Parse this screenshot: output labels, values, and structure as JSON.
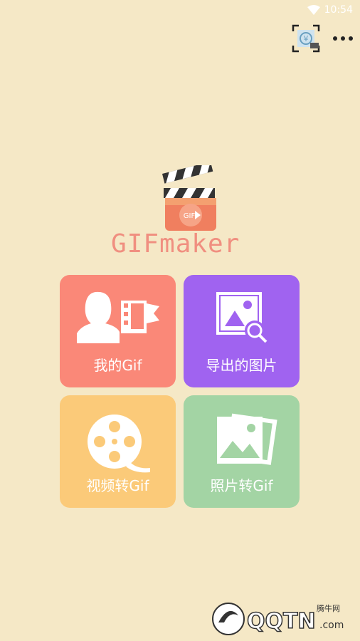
{
  "status_bar": {
    "time": "10:54"
  },
  "top_actions": {
    "donate_icon": "donate-code-icon",
    "more_icon": "more-dots-icon"
  },
  "logo": {
    "title": "GIFmaker",
    "badge": "GIF"
  },
  "tiles": [
    {
      "label": "我的Gif",
      "icon": "person-film-icon",
      "color": "#fa8878"
    },
    {
      "label": "导出的图片",
      "icon": "image-search-icon",
      "color": "#a063f0"
    },
    {
      "label": "视频转Gif",
      "icon": "film-reel-icon",
      "color": "#fbca79"
    },
    {
      "label": "照片转Gif",
      "icon": "photos-stack-icon",
      "color": "#a3d4a4"
    }
  ],
  "watermark": {
    "brand": "QQTN",
    "suffix": ".com",
    "cn": "腾牛网"
  }
}
